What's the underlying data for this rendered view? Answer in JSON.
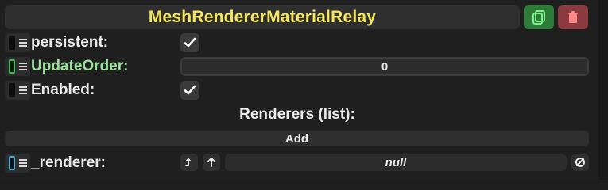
{
  "header": {
    "title": "MeshRendererMaterialRelay",
    "copy_icon": "copy-icon",
    "delete_icon": "trash-icon",
    "accent_title": "#f4e75d",
    "accent_copy": "#2f7c3a",
    "accent_delete": "#8b3a3f"
  },
  "fields": {
    "persistent": {
      "label": "persistent:",
      "checked": true
    },
    "update_order": {
      "label": "UpdateOrder:",
      "value": "0"
    },
    "enabled": {
      "label": "Enabled:",
      "checked": true
    }
  },
  "renderers": {
    "section_title": "Renderers (list):",
    "add_label": "Add",
    "item": {
      "label": "_renderer:",
      "value": "null",
      "jump_icon": "jump-icon",
      "up_icon": "arrow-up-icon",
      "clear_icon": "null-icon"
    }
  }
}
